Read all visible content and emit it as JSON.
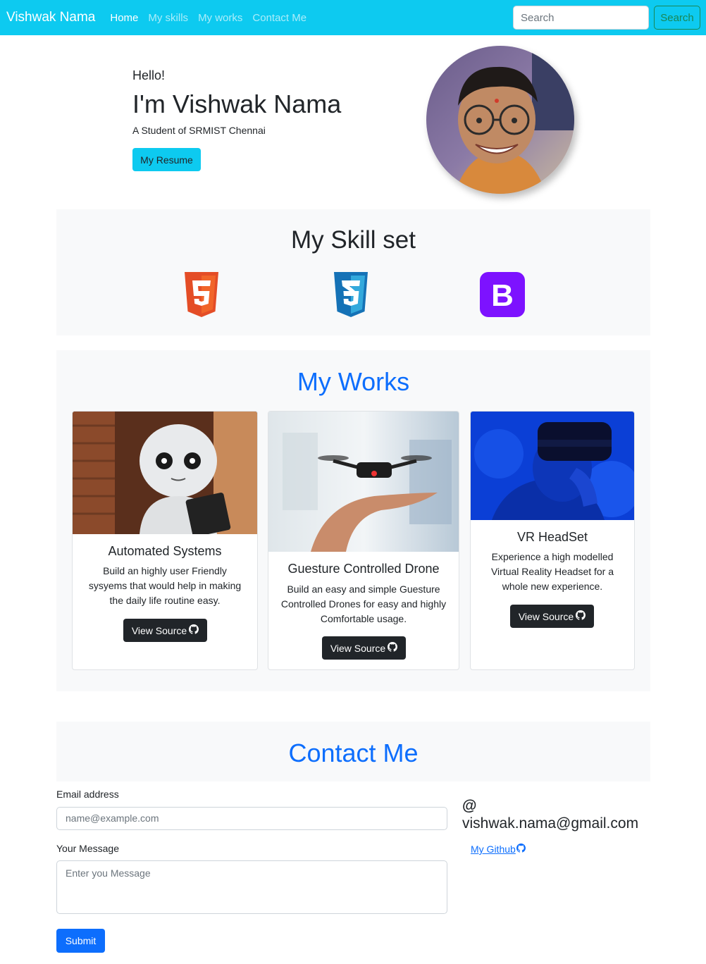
{
  "nav": {
    "brand": "Vishwak Nama",
    "links": [
      "Home",
      "My skills",
      "My works",
      "Contact Me"
    ],
    "search_placeholder": "Search",
    "search_button": "Search"
  },
  "hero": {
    "greeting": "Hello!",
    "title": "I'm Vishwak Nama",
    "subtitle": "A Student of SRMIST Chennai",
    "resume_button": "My Resume"
  },
  "skills": {
    "title": "My Skill set",
    "icons": [
      "html5-icon",
      "css3-icon",
      "bootstrap-icon"
    ],
    "bootstrap_letter": "B"
  },
  "works": {
    "title": "My Works",
    "cards": [
      {
        "title": "Automated Systems",
        "text": "Build an highly user Friendly sysyems that would help in making the daily life routine easy.",
        "button": "View Source"
      },
      {
        "title": "Guesture Controlled Drone",
        "text": "Build an easy and simple Guesture Controlled Drones for easy and highly Comfortable usage.",
        "button": "View Source"
      },
      {
        "title": "VR HeadSet",
        "text": "Experience a high modelled Virtual Reality Headset for a whole new experience.",
        "button": "View Source"
      }
    ]
  },
  "contact": {
    "title": "Contact Me",
    "email_label": "Email address",
    "email_placeholder": "name@example.com",
    "message_label": "Your Message",
    "message_placeholder": "Enter you Message",
    "submit": "Submit",
    "at_symbol": "@",
    "email": "vishwak.nama@gmail.com",
    "github": "My Github"
  },
  "colors": {
    "navbar": "#0dcaf0",
    "primary": "#0d6efd",
    "dark": "#212529",
    "light_bg": "#f8f9fa",
    "html5": "#e44d26",
    "css3": "#1572b6",
    "bootstrap": "#7952b3"
  }
}
